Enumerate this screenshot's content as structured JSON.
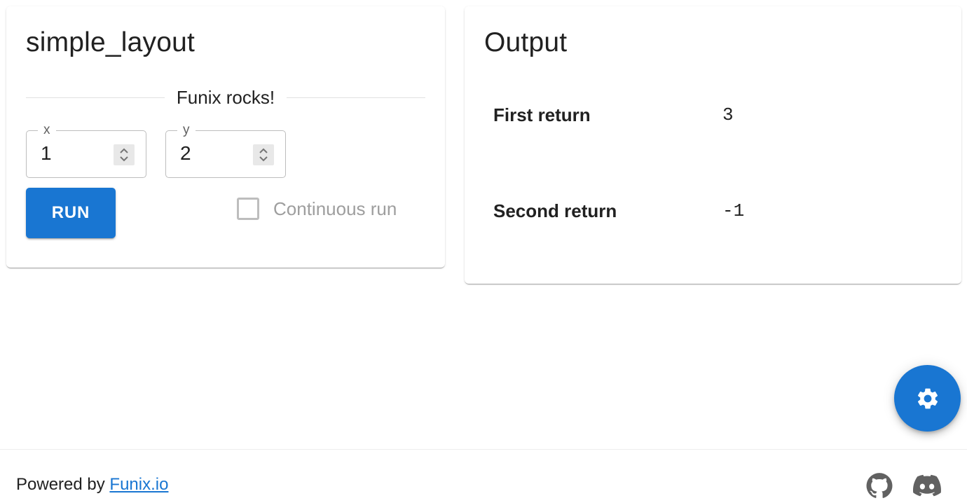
{
  "input_panel": {
    "title": "simple_layout",
    "divider_text": "Funix rocks!",
    "fields": [
      {
        "label": "x",
        "value": "1"
      },
      {
        "label": "y",
        "value": "2"
      }
    ],
    "run_label": "RUN",
    "continuous_label": "Continuous run",
    "continuous_checked": false
  },
  "output_panel": {
    "title": "Output",
    "rows": [
      {
        "label": "First return",
        "value": "3"
      },
      {
        "label": "Second return",
        "value": "-1"
      }
    ]
  },
  "fab": {
    "icon": "gear-icon"
  },
  "footer": {
    "powered_prefix": "Powered by",
    "powered_link": "Funix.io",
    "icons": [
      "github-icon",
      "discord-icon"
    ]
  },
  "colors": {
    "primary": "#1976d2",
    "text": "#212121",
    "muted": "#9e9e9e"
  }
}
